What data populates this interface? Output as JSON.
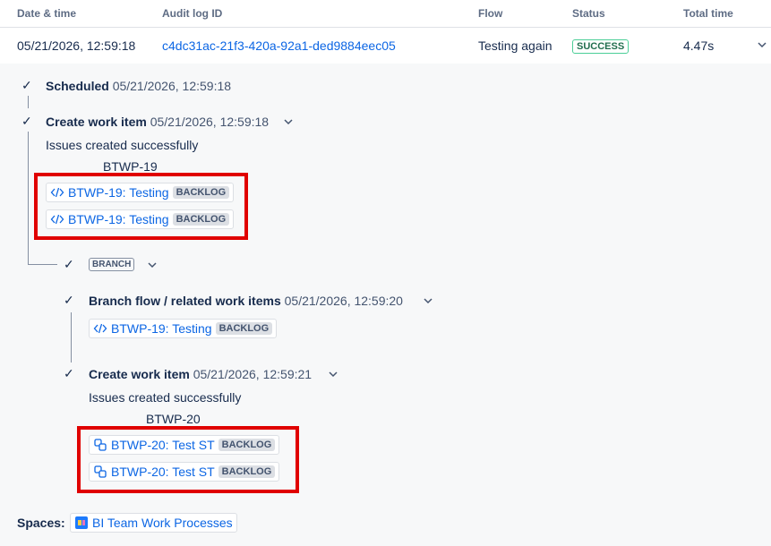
{
  "table": {
    "headers": {
      "date": "Date & time",
      "audit": "Audit log ID",
      "flow": "Flow",
      "status": "Status",
      "total": "Total time"
    },
    "row": {
      "date": "05/21/2026, 12:59:18",
      "audit_id": "c4dc31ac-21f3-420a-92a1-ded9884eec05",
      "flow": "Testing again",
      "status": "SUCCESS",
      "total": "4.47s"
    }
  },
  "steps": {
    "scheduled": {
      "title": "Scheduled",
      "time": "05/21/2026, 12:59:18"
    },
    "create1": {
      "title": "Create work item",
      "time": "05/21/2026, 12:59:18",
      "message": "Issues created successfully",
      "issue_key": "BTWP-19",
      "links": [
        {
          "text": "BTWP-19: Testing",
          "status": "BACKLOG",
          "icon": "code-icon"
        },
        {
          "text": "BTWP-19: Testing",
          "status": "BACKLOG",
          "icon": "code-icon"
        }
      ]
    },
    "branch": {
      "label": "BRANCH"
    },
    "branch_flow": {
      "title": "Branch flow / related work items",
      "time": "05/21/2026, 12:59:20",
      "links": [
        {
          "text": "BTWP-19: Testing",
          "status": "BACKLOG",
          "icon": "code-icon"
        }
      ]
    },
    "create2": {
      "title": "Create work item",
      "time": "05/21/2026, 12:59:21",
      "message": "Issues created successfully",
      "issue_key": "BTWP-20",
      "links": [
        {
          "text": "BTWP-20: Test ST",
          "status": "BACKLOG",
          "icon": "subtask-icon"
        },
        {
          "text": "BTWP-20: Test ST",
          "status": "BACKLOG",
          "icon": "subtask-icon"
        }
      ]
    }
  },
  "spaces": {
    "label": "Spaces:",
    "name": "BI Team Work Processes"
  },
  "colors": {
    "link": "#0c66e4",
    "success": "#216e4e",
    "highlight": "#e00000"
  }
}
